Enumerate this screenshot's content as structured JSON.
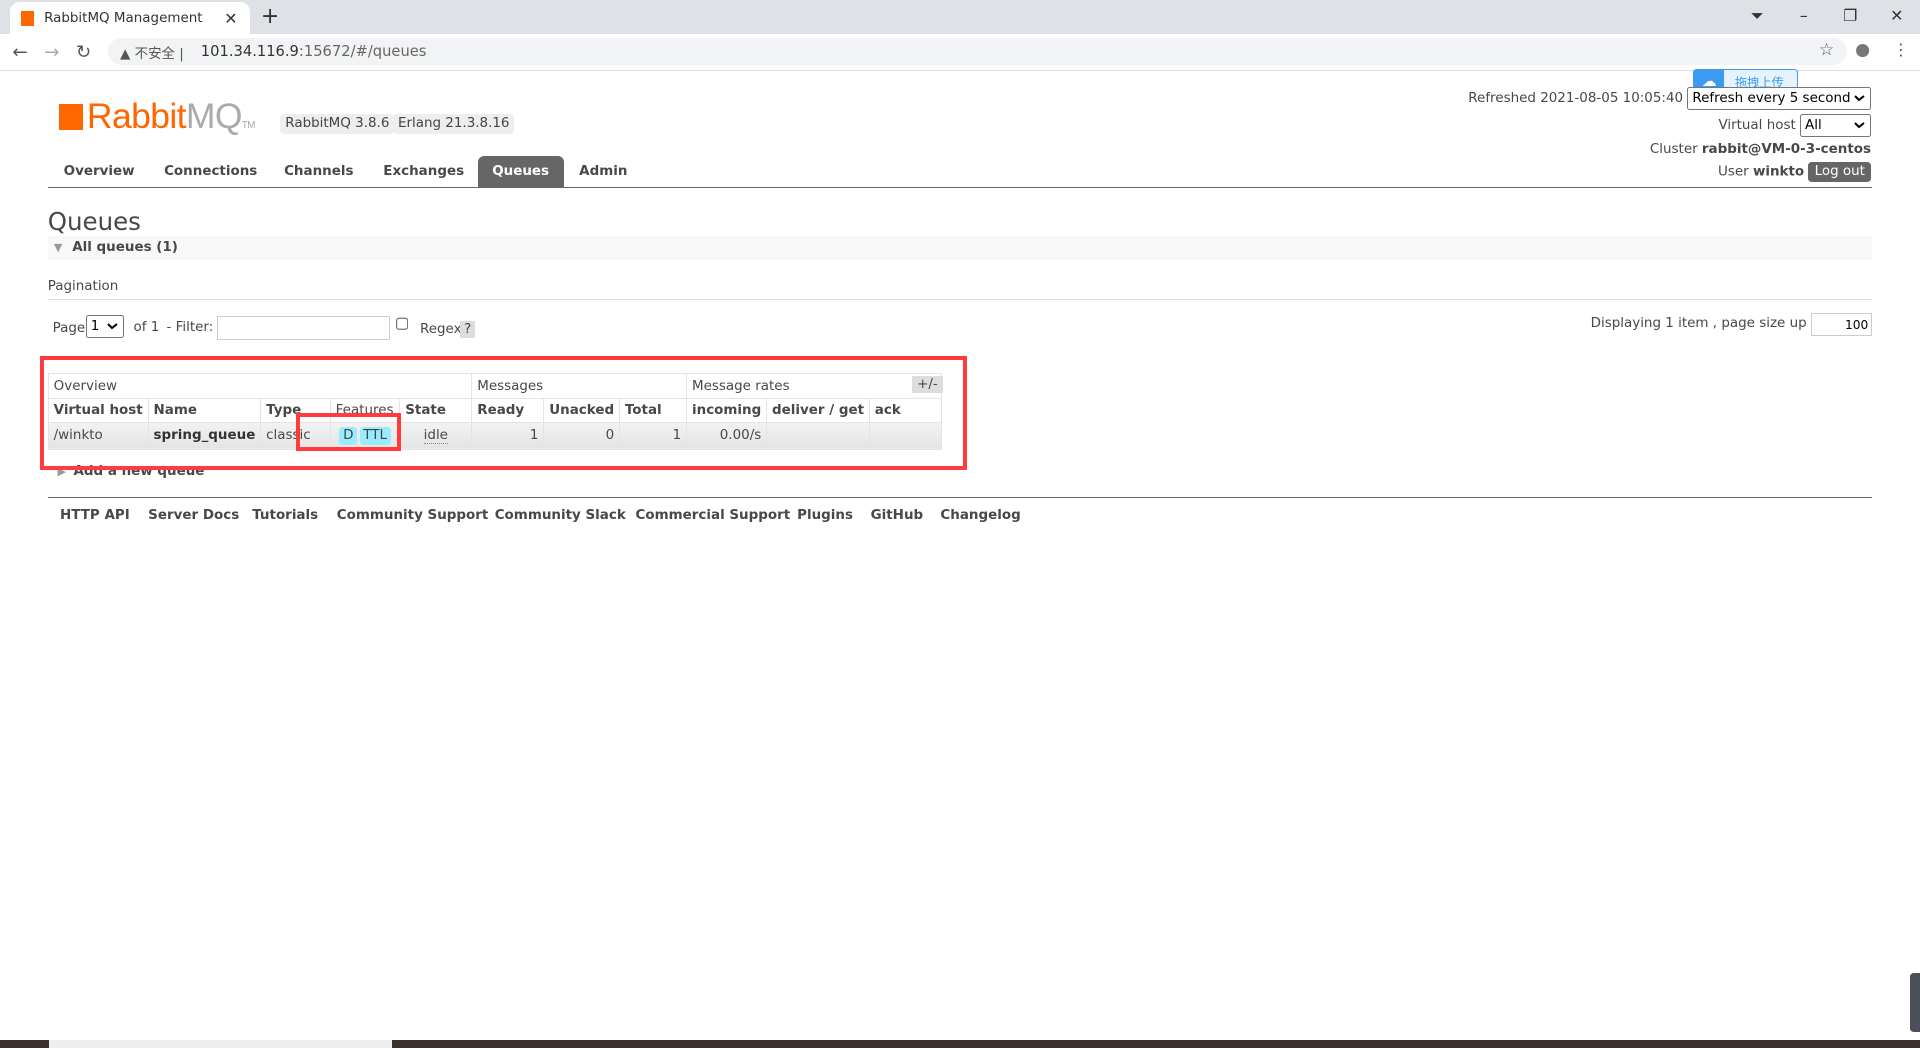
{
  "browser": {
    "tab_title": "RabbitMQ Management",
    "security_label": "不安全",
    "url_host": "101.34.116.9",
    "url_rest": ":15672/#/queues"
  },
  "header": {
    "logo_rabbit": "Rabbit",
    "logo_mq": "MQ",
    "logo_tm": "TM",
    "rabbitmq_version": "RabbitMQ 3.8.6",
    "erlang_version": "Erlang 21.3.8.16",
    "refreshed": "Refreshed 2021-08-05 10:05:40",
    "refresh_option": "Refresh every 5 seconds",
    "vhost_label": "Virtual host",
    "vhost_option": "All",
    "cluster_label": "Cluster",
    "cluster_name": "rabbit@VM-0-3-centos",
    "user_label": "User",
    "user_name": "winkto",
    "logout": "Log out",
    "upload_widget": "拖拽上传"
  },
  "nav": [
    "Overview",
    "Connections",
    "Channels",
    "Exchanges",
    "Queues",
    "Admin"
  ],
  "page": {
    "title": "Queues",
    "section": "All queues (1)",
    "pagination_label": "Pagination",
    "page_label": "Page",
    "page_value": "1",
    "of_label": "of 1",
    "filter_label": "- Filter:",
    "filter_value": "",
    "regex_label": "Regex",
    "help": "?",
    "displaying": "Displaying 1 item , page size up to:",
    "page_size": "100",
    "plus_minus": "+/-",
    "add_queue": "Add a new queue"
  },
  "table": {
    "groups": [
      "Overview",
      "Messages",
      "Message rates"
    ],
    "columns": [
      "Virtual host",
      "Name",
      "Type",
      "Features",
      "State",
      "Ready",
      "Unacked",
      "Total",
      "incoming",
      "deliver / get",
      "ack"
    ],
    "rows": [
      {
        "vhost": "/winkto",
        "name": "spring_queue",
        "type": "classic",
        "features": [
          "D",
          "TTL"
        ],
        "state": "idle",
        "ready": "1",
        "unacked": "0",
        "total": "1",
        "incoming": "0.00/s",
        "deliver_get": "",
        "ack": ""
      }
    ]
  },
  "footer": [
    "HTTP API",
    "Server Docs",
    "Tutorials",
    "Community Support",
    "Community Slack",
    "Commercial Support",
    "Plugins",
    "GitHub",
    "Changelog"
  ],
  "colors": {
    "brand": "#ff6600",
    "nav_active": "#666666",
    "highlight": "#ff3b3b",
    "feature_badge": "#99ebff"
  }
}
